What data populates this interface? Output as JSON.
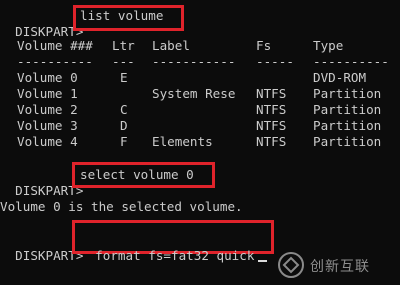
{
  "prompt": "DISKPART>",
  "commands": {
    "list_volume": "list volume",
    "select_volume": "select volume 0",
    "format": "format fs=fat32 quick"
  },
  "table": {
    "headers": [
      "Volume ###",
      "Ltr",
      "Label",
      "Fs",
      "Type"
    ],
    "separators": [
      "----------",
      "---",
      "-----------",
      "-----",
      "----------"
    ],
    "rows": [
      [
        "Volume 0",
        "E",
        "",
        "",
        "DVD-ROM"
      ],
      [
        "Volume 1",
        "",
        "System Rese",
        "NTFS",
        "Partition"
      ],
      [
        "Volume 2",
        "C",
        "",
        "NTFS",
        "Partition"
      ],
      [
        "Volume 3",
        "D",
        "",
        "NTFS",
        "Partition"
      ],
      [
        "Volume 4",
        "F",
        "Elements",
        "NTFS",
        "Partition"
      ]
    ]
  },
  "message": "Volume 0 is the selected volume.",
  "watermark": "创新互联",
  "highlight_color": "#e0232b"
}
